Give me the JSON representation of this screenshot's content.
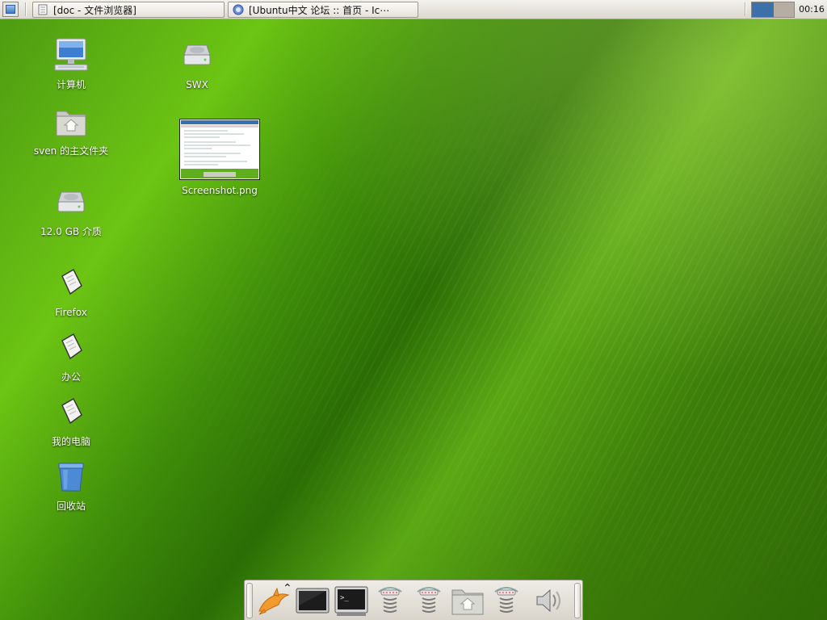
{
  "top_panel": {
    "tasks": [
      {
        "label": "[doc - 文件浏览器]",
        "icon": "file-manager-icon"
      },
      {
        "label": "[Ubuntu中文 论坛 :: 首页 - Ic⋯",
        "icon": "web-browser-icon"
      }
    ],
    "clock": "00:16"
  },
  "desktop": {
    "icons": [
      {
        "label": "计算机",
        "icon": "computer-icon"
      },
      {
        "label": "sven 的主文件夹",
        "icon": "home-folder-icon"
      },
      {
        "label": "12.0 GB 介质",
        "icon": "drive-icon"
      },
      {
        "label": "Firefox",
        "icon": "document-icon"
      },
      {
        "label": "办公",
        "icon": "document-icon"
      },
      {
        "label": "我的电脑",
        "icon": "document-icon"
      },
      {
        "label": "回收站",
        "icon": "trash-icon"
      },
      {
        "label": "SWX",
        "icon": "drive-icon"
      },
      {
        "label": "Screenshot.png",
        "icon": "image-thumbnail-icon"
      }
    ]
  },
  "dock": {
    "items": [
      "dolphin-icon",
      "expand-chevron-icon",
      "monitor-icon",
      "terminal-icon",
      "spring-launcher-icon",
      "spring-launcher-icon",
      "home-folder-icon",
      "spring-launcher-icon",
      "volume-icon"
    ]
  },
  "colors": {
    "workspace_active": "#3d6fa8",
    "workspace_inactive": "#b6aea3"
  }
}
